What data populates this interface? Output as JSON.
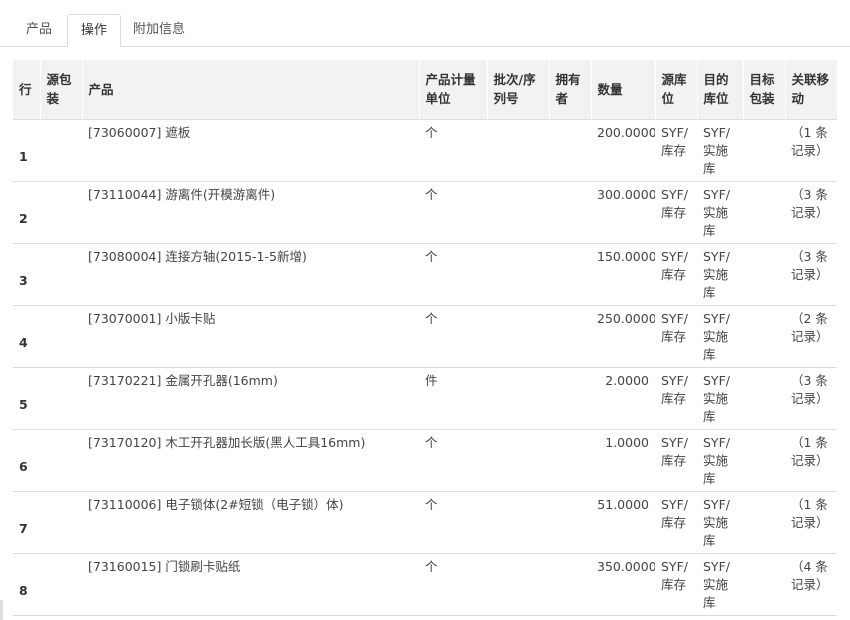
{
  "tabs": [
    {
      "label": "产品",
      "active": false
    },
    {
      "label": "操作",
      "active": true
    },
    {
      "label": "附加信息",
      "active": false
    }
  ],
  "columns": [
    "行",
    "源包装",
    "产品",
    "产品计量单位",
    "批次/序列号",
    "拥有者",
    "数量",
    "源库位",
    "目的库位",
    "目标包装",
    "关联移动"
  ],
  "rows": [
    {
      "line": "1",
      "src_pkg": "",
      "product": "[73060007] 遮板",
      "uom": "个",
      "lot": "",
      "owner": "",
      "qty": "200.0000",
      "src_loc": "SYF/库存",
      "dest_loc": "SYF/实施库",
      "dest_pkg": "",
      "moves": "（1 条记录）"
    },
    {
      "line": "2",
      "src_pkg": "",
      "product": "[73110044] 游离件(开模游离件)",
      "uom": "个",
      "lot": "",
      "owner": "",
      "qty": "300.0000",
      "src_loc": "SYF/库存",
      "dest_loc": "SYF/实施库",
      "dest_pkg": "",
      "moves": "（3 条记录）"
    },
    {
      "line": "3",
      "src_pkg": "",
      "product": "[73080004] 连接方轴(2015-1-5新增)",
      "uom": "个",
      "lot": "",
      "owner": "",
      "qty": "150.0000",
      "src_loc": "SYF/库存",
      "dest_loc": "SYF/实施库",
      "dest_pkg": "",
      "moves": "（3 条记录）"
    },
    {
      "line": "4",
      "src_pkg": "",
      "product": "[73070001] 小版卡贴",
      "uom": "个",
      "lot": "",
      "owner": "",
      "qty": "250.0000",
      "src_loc": "SYF/库存",
      "dest_loc": "SYF/实施库",
      "dest_pkg": "",
      "moves": "（2 条记录）"
    },
    {
      "line": "5",
      "src_pkg": "",
      "product": "[73170221] 金属开孔器(16mm)",
      "uom": "件",
      "lot": "",
      "owner": "",
      "qty": "2.0000",
      "src_loc": "SYF/库存",
      "dest_loc": "SYF/实施库",
      "dest_pkg": "",
      "moves": "（3 条记录）"
    },
    {
      "line": "6",
      "src_pkg": "",
      "product": "[73170120] 木工开孔器加长版(黑人工具16mm)",
      "uom": "个",
      "lot": "",
      "owner": "",
      "qty": "1.0000",
      "src_loc": "SYF/库存",
      "dest_loc": "SYF/实施库",
      "dest_pkg": "",
      "moves": "（1 条记录）"
    },
    {
      "line": "7",
      "src_pkg": "",
      "product": "[73110006] 电子锁体(2#短锁（电子锁）体)",
      "uom": "个",
      "lot": "",
      "owner": "",
      "qty": "51.0000",
      "src_loc": "SYF/库存",
      "dest_loc": "SYF/实施库",
      "dest_pkg": "",
      "moves": "（1 条记录）"
    },
    {
      "line": "8",
      "src_pkg": "",
      "product": "[73160015] 门锁刷卡贴纸",
      "uom": "个",
      "lot": "",
      "owner": "",
      "qty": "350.0000",
      "src_loc": "SYF/库存",
      "dest_loc": "SYF/实施库",
      "dest_pkg": "",
      "moves": "（4 条记录）"
    }
  ]
}
